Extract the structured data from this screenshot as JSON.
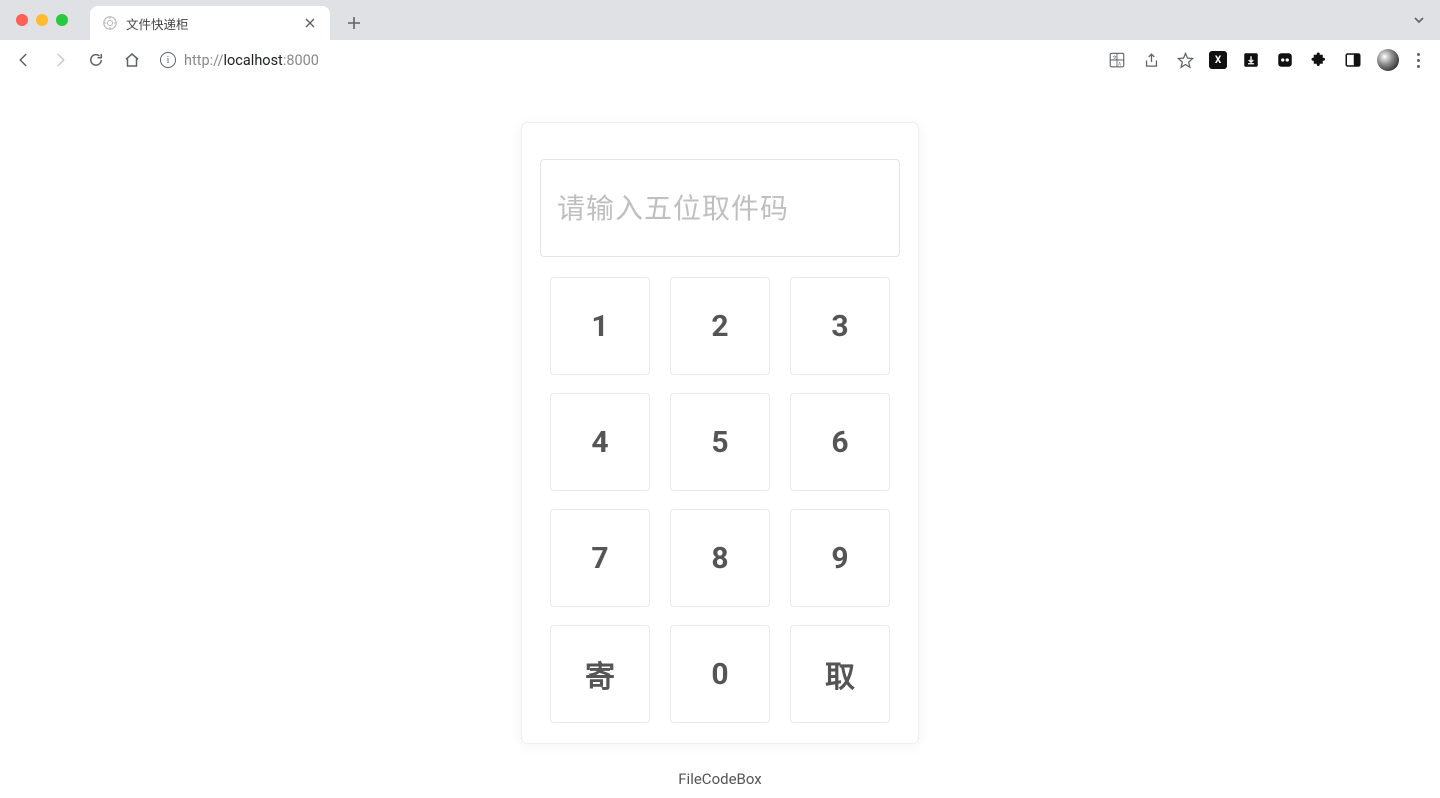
{
  "browser": {
    "tab_title": "文件快递柜",
    "url_prefix": "http://",
    "url_host": "localhost",
    "url_port": ":8000"
  },
  "input": {
    "placeholder": "请输入五位取件码",
    "value": ""
  },
  "keypad": {
    "keys": [
      "1",
      "2",
      "3",
      "4",
      "5",
      "6",
      "7",
      "8",
      "9",
      "寄",
      "0",
      "取"
    ]
  },
  "footer": {
    "label": "FileCodeBox"
  }
}
